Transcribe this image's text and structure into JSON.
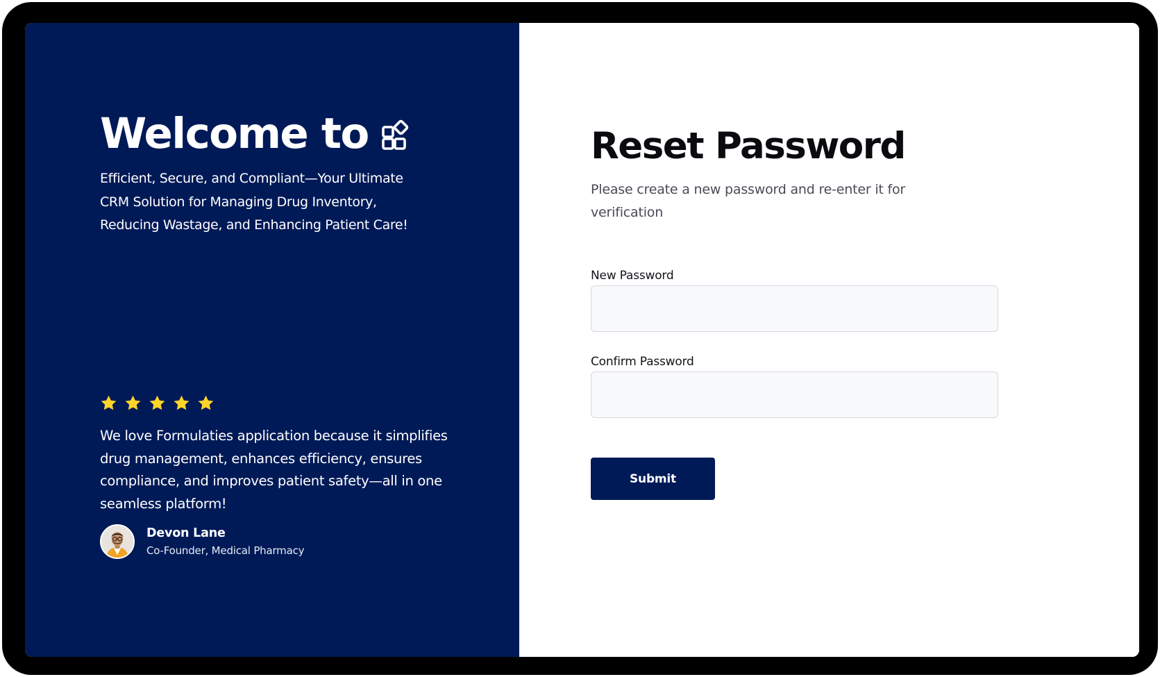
{
  "left_panel": {
    "welcome_title": "Welcome to",
    "logo_icon": "grid-app-icon",
    "tagline": "Efficient, Secure, and Compliant—Your Ultimate CRM Solution for Managing Drug Inventory, Reducing Wastage, and Enhancing Patient Care!",
    "testimonial": {
      "rating": 5,
      "rating_max": 5,
      "star_color": "#ffd42a",
      "quote": "We love Formulaties application because it simplifies drug management, enhances efficiency, ensures compliance, and improves patient safety—all in one seamless platform!",
      "author_name": "Devon Lane",
      "author_role": "Co-Founder, Medical Pharmacy"
    }
  },
  "form": {
    "title": "Reset Password",
    "subtitle": "Please create a new password and re-enter it for verification",
    "new_password_label": "New Password",
    "new_password_value": "",
    "confirm_password_label": "Confirm Password",
    "confirm_password_value": "",
    "submit_label": "Submit"
  },
  "colors": {
    "brand_navy": "#001a57",
    "star_yellow": "#ffd42a",
    "input_bg": "#f8f9fb",
    "input_border": "#d4d8df"
  }
}
